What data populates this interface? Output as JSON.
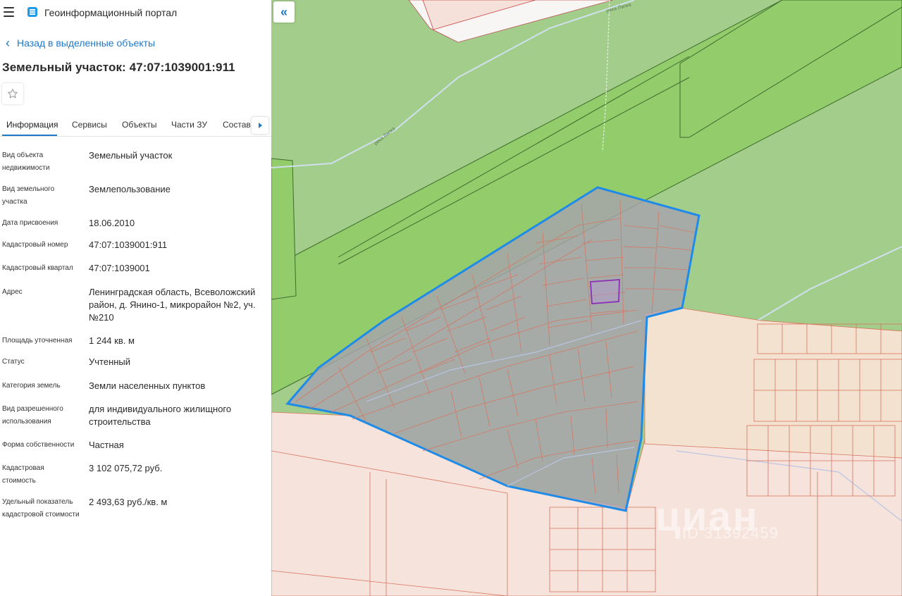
{
  "header": {
    "app_title": "Геоинформационный портал"
  },
  "nav": {
    "back_label": "Назад в выделенные объекты"
  },
  "object": {
    "title": "Земельный участок: 47:07:1039001:911"
  },
  "tabs": [
    {
      "label": "Информация"
    },
    {
      "label": "Сервисы"
    },
    {
      "label": "Объекты"
    },
    {
      "label": "Части ЗУ"
    },
    {
      "label": "Состав"
    }
  ],
  "properties": [
    {
      "label": "Вид объекта недвижимости",
      "value": "Земельный участок"
    },
    {
      "label": "Вид земельного участка",
      "value": "Землепользование"
    },
    {
      "label": "Дата присвоения",
      "value": "18.06.2010"
    },
    {
      "label": "Кадастровый номер",
      "value": "47:07:1039001:911"
    },
    {
      "label": "Кадастровый квартал",
      "value": "47:07:1039001"
    },
    {
      "label": "Адрес",
      "value": "Ленинградская область, Всеволожский район, д. Янино-1, микрорайон №2, уч.№210"
    },
    {
      "label": "Площадь уточненная",
      "value": "1 244 кв. м"
    },
    {
      "label": "Статус",
      "value": "Учтенный"
    },
    {
      "label": "Категория земель",
      "value": "Земли населенных пунктов"
    },
    {
      "label": "Вид разрешенного использования",
      "value": "для индивидуального жилищного строительства"
    },
    {
      "label": "Форма собственности",
      "value": "Частная"
    },
    {
      "label": "Кадастровая стоимость",
      "value": "3 102 075,72 руб."
    },
    {
      "label": "Удельный показатель кадастровой стоимости",
      "value": "2 493,63 руб./кв. м"
    }
  ],
  "map": {
    "watermark": "циан",
    "watermark_sub": "ID 31392459",
    "street_label_1": "река Лапка",
    "street_label_2": "река Лапка",
    "colors": {
      "forest": "#a3cd8a",
      "bright_green": "#92cc6a",
      "settlement": "#f6e3dc",
      "highlight": "#1e8be8"
    }
  }
}
